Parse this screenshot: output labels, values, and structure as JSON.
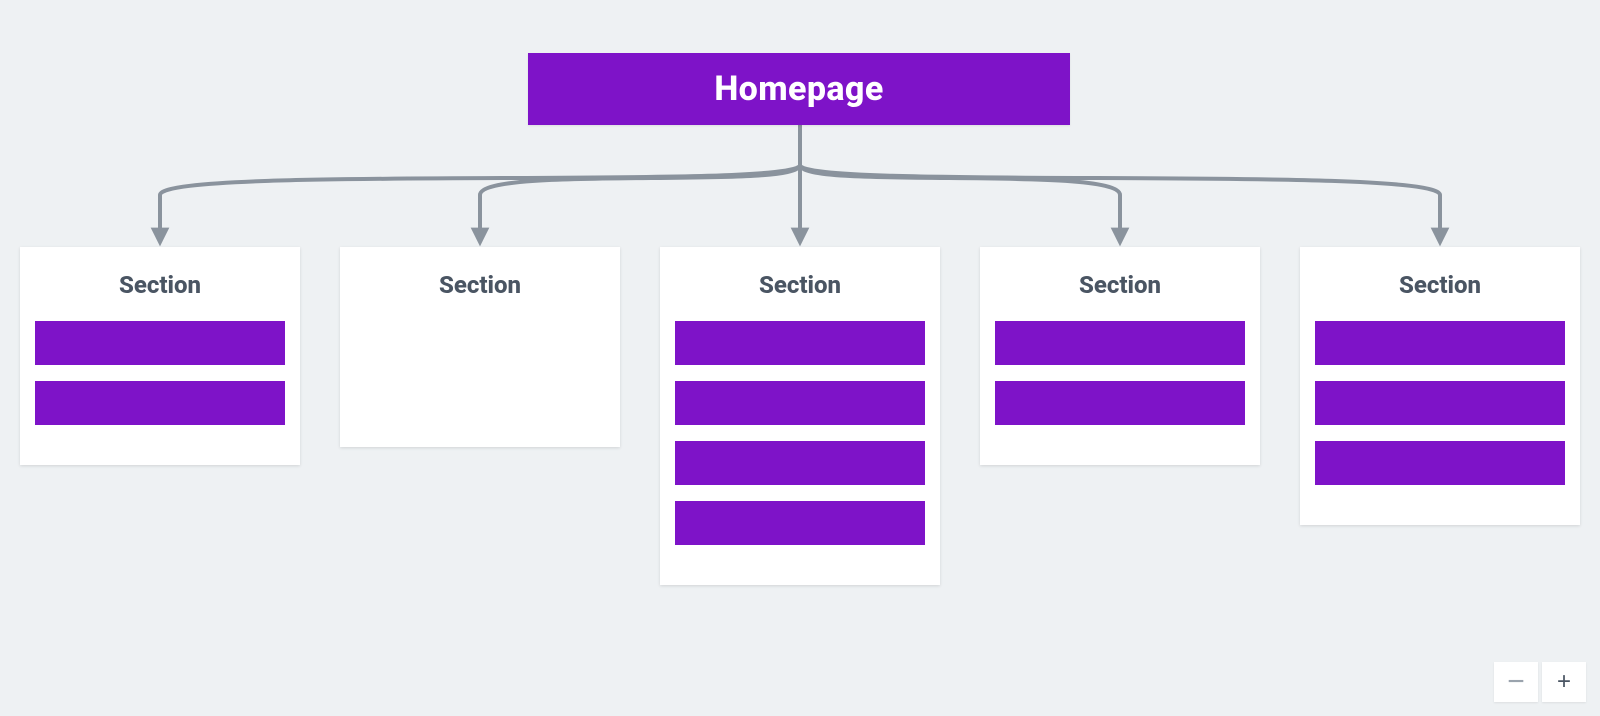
{
  "colors": {
    "accent": "#7e13c8",
    "background": "#eef1f3",
    "text": "#4a5563",
    "arrow": "#8a939d"
  },
  "root": {
    "label": "Homepage"
  },
  "sections": [
    {
      "label": "Section",
      "subpages": 2
    },
    {
      "label": "Section",
      "subpages": 0
    },
    {
      "label": "Section",
      "subpages": 4
    },
    {
      "label": "Section",
      "subpages": 2
    },
    {
      "label": "Section",
      "subpages": 3
    }
  ],
  "zoom": {
    "minus_label": "−",
    "plus_label": "+"
  }
}
